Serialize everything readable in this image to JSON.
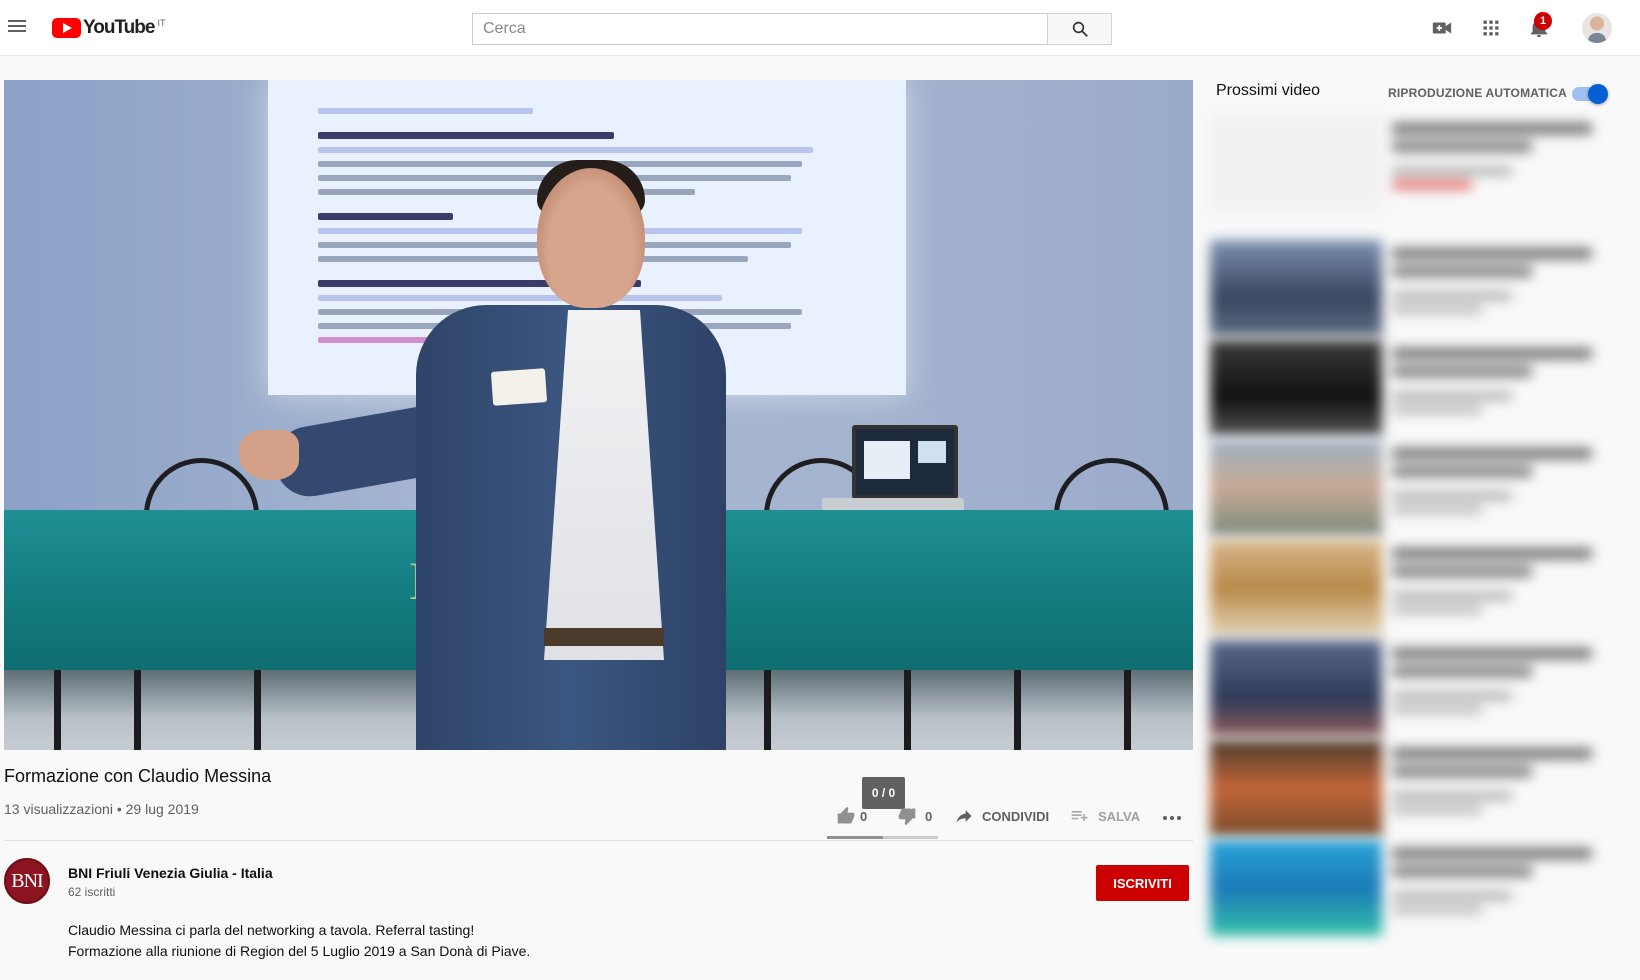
{
  "header": {
    "logo_text": "YouTube",
    "logo_country": "IT",
    "search_placeholder": "Cerca",
    "notifications_count": "1"
  },
  "video": {
    "title": "Formazione con Claudio Messina",
    "meta": "13 visualizzazioni • 29 lug 2019",
    "tooltip": "0 / 0",
    "likes": "0",
    "dislikes": "0",
    "share_label": "CONDIVIDI",
    "save_label": "SALVA",
    "sentiment_fraction": 0.5
  },
  "channel": {
    "avatar_text": "BNI",
    "name": "BNI Friuli Venezia Giulia - Italia",
    "subscribers": "62 iscritti",
    "subscribe_label": "ISCRIVITI"
  },
  "description": [
    "Claudio Messina ci parla del networking a tavola. Referral tasting!",
    "Formazione alla riunione di Region del 5 Luglio 2019 a San Donà di Piave."
  ],
  "sidebar": {
    "up_next_label": "Prossimi video",
    "autoplay_label": "RIPRODUZIONE AUTOMATICA",
    "autoplay_on": true
  },
  "icons": {
    "menu": "hamburger-menu-icon",
    "search": "search-icon",
    "upload": "video-camera-plus-icon",
    "apps": "apps-grid-icon",
    "notifications": "bell-icon",
    "like": "thumbs-up-icon",
    "dislike": "thumbs-down-icon",
    "share": "share-arrow-icon",
    "save": "playlist-add-icon",
    "more": "more-horizontal-icon"
  },
  "colors": {
    "brand_red": "#ff0000",
    "subscribe_red": "#cc0000",
    "toggle_blue": "#065fd4",
    "text_secondary": "#606060"
  }
}
